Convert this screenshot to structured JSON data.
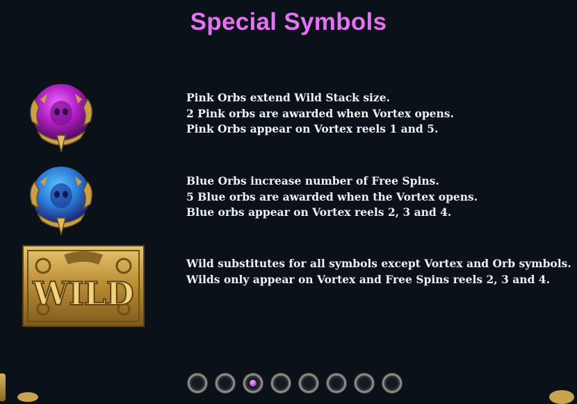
{
  "title": "Special Symbols",
  "symbols": [
    {
      "icon": "pink-orb-icon",
      "lines": [
        "Pink Orbs extend Wild Stack size.",
        "2 Pink orbs are awarded when Vortex opens.",
        "Pink Orbs appear on Vortex reels 1 and 5."
      ]
    },
    {
      "icon": "blue-orb-icon",
      "lines": [
        "Blue Orbs increase number of Free Spins.",
        "5 Blue orbs are awarded when the Vortex opens.",
        "Blue orbs appear on Vortex reels 2, 3 and 4."
      ]
    },
    {
      "icon": "wild-symbol-icon",
      "label": "WILD",
      "lines": [
        "Wild substitutes for all symbols except Vortex and Orb symbols.",
        "Wilds only appear on Vortex and Free Spins reels 2, 3 and 4."
      ]
    }
  ],
  "pager": {
    "pages": 8,
    "current": 3
  },
  "colors": {
    "title": "#e472f3",
    "pink_orb": "#b21fc4",
    "blue_orb": "#2d7fd8",
    "gold": "#c9a04a"
  }
}
